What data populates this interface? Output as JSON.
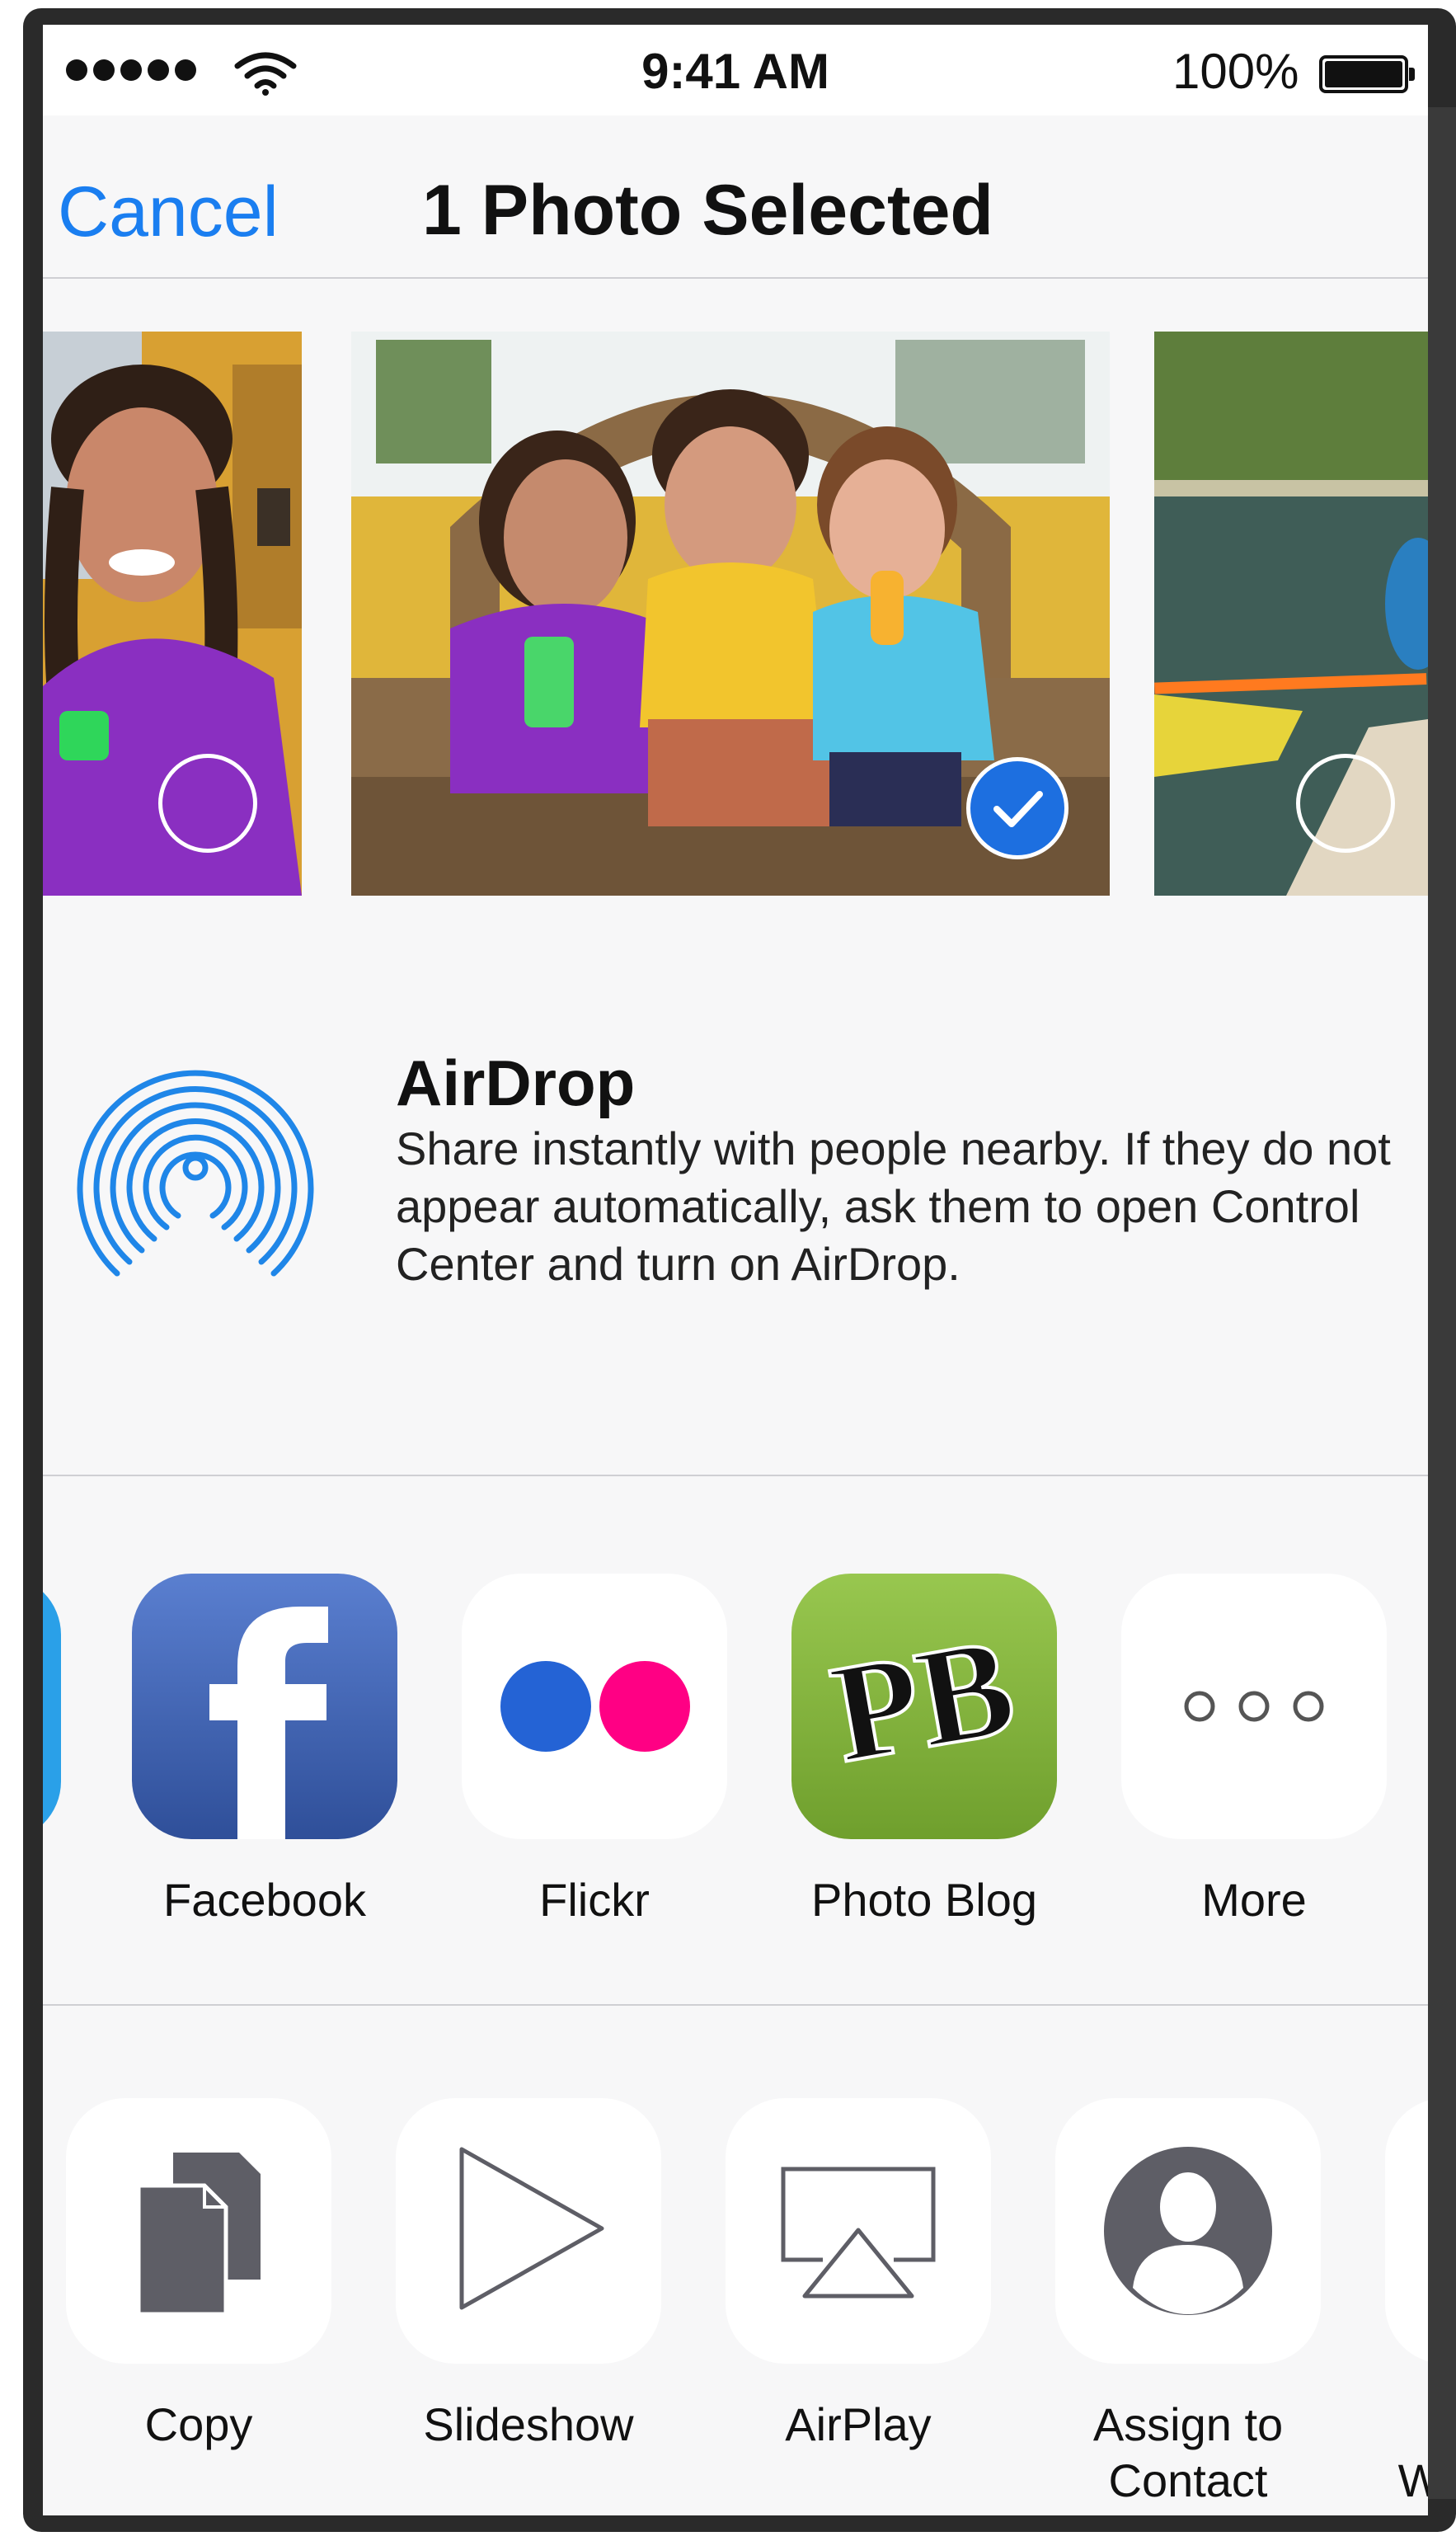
{
  "status_bar": {
    "time": "9:41 AM",
    "battery_percent": "100%",
    "signal_bars": 5,
    "wifi_icon": "wifi-icon",
    "battery_level": 1.0
  },
  "nav": {
    "cancel_label": "Cancel",
    "title": "1 Photo Selected"
  },
  "photos": [
    {
      "name": "girl-portrait",
      "selected": false
    },
    {
      "name": "three-kids-on-bench",
      "selected": true
    },
    {
      "name": "kayak-on-lake",
      "selected": false
    }
  ],
  "airdrop": {
    "title": "AirDrop",
    "description": "Share instantly with people nearby. If they do not appear automatically, ask them to open Control Center and turn on AirDrop."
  },
  "share_apps": [
    {
      "label": "Facebook",
      "icon": "facebook-icon"
    },
    {
      "label": "Flickr",
      "icon": "flickr-icon"
    },
    {
      "label": "Photo Blog",
      "icon": "photo-blog-icon",
      "icon_text": "PB"
    },
    {
      "label": "More",
      "icon": "more-icon"
    }
  ],
  "actions": [
    {
      "label": "Copy",
      "icon": "copy-icon"
    },
    {
      "label": "Slideshow",
      "icon": "slideshow-icon"
    },
    {
      "label": "AirPlay",
      "icon": "airplay-icon"
    },
    {
      "label": "Assign to\nContact",
      "label_lines": [
        "Assign to",
        "Contact"
      ],
      "icon": "contact-icon"
    },
    {
      "label_partial": "W",
      "icon": "partial-action-icon"
    }
  ],
  "colors": {
    "accent": "#1a7ef0",
    "separator": "#cfcfd3",
    "background": "#f7f7f8",
    "facebook": "#3b5998",
    "flickr_blue": "#2463d5",
    "flickr_pink": "#ff0084",
    "photo_blog_green": "#7fae3a"
  }
}
